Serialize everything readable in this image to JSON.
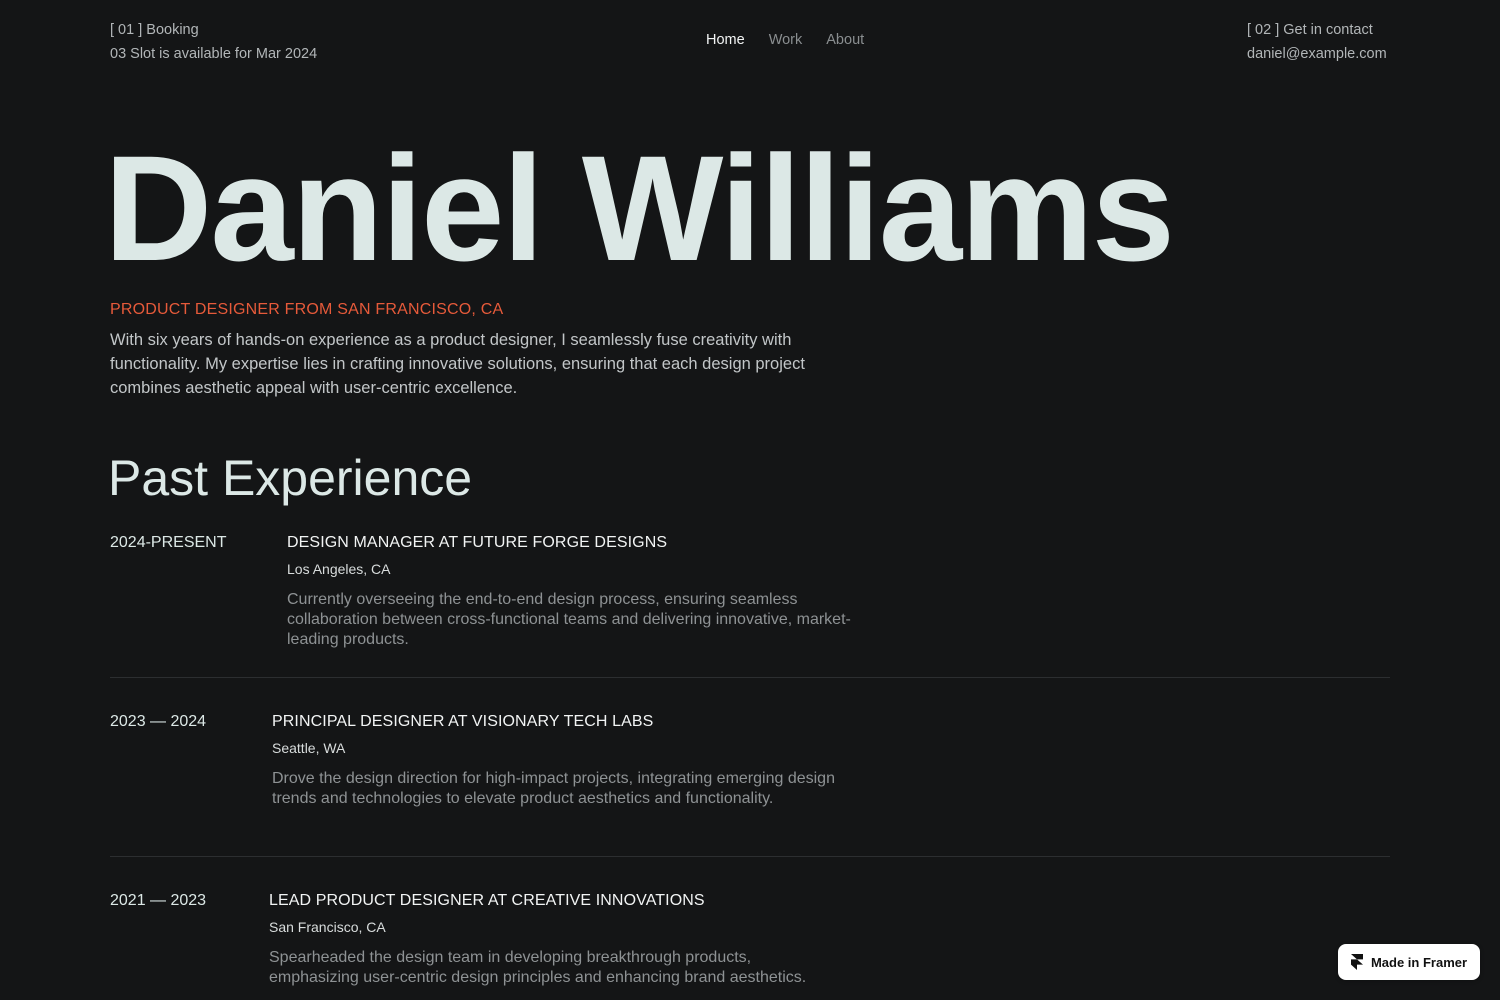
{
  "header": {
    "booking_label": "[ 01 ] Booking",
    "booking_status": "03 Slot is available for Mar 2024",
    "contact_label": "[ 02 ] Get in contact",
    "contact_email": "daniel@example.com",
    "nav": [
      {
        "label": "Home",
        "active": true
      },
      {
        "label": "Work",
        "active": false
      },
      {
        "label": "About",
        "active": false
      }
    ]
  },
  "hero": {
    "name": "Daniel Williams",
    "tagline": "PRODUCT DESIGNER FROM SAN FRANCISCO, CA",
    "intro": "With six years of hands-on experience as a product designer, I seamlessly fuse creativity with functionality. My expertise lies in crafting innovative solutions, ensuring that each design project combines aesthetic appeal with user-centric excellence."
  },
  "experience": {
    "title": "Past Experience",
    "items": [
      {
        "date": "2024-PRESENT",
        "title": "DESIGN MANAGER AT FUTURE FORGE DESIGNS",
        "location": "Los Angeles, CA",
        "description": "Currently overseeing the end-to-end design process, ensuring seamless collaboration between cross-functional teams and delivering innovative, market-leading products."
      },
      {
        "date": "2023 — 2024",
        "title": "PRINCIPAL DESIGNER AT VISIONARY TECH LABS",
        "location": "Seattle, WA",
        "description": "Drove the design direction for high-impact projects, integrating emerging design trends and technologies to elevate product aesthetics and functionality."
      },
      {
        "date": "2021 — 2023",
        "title": "LEAD PRODUCT DESIGNER AT CREATIVE INNOVATIONS",
        "location": "San Francisco, CA",
        "description": "Spearheaded the design team in developing breakthrough products, emphasizing user-centric design principles and enhancing brand aesthetics."
      }
    ]
  },
  "badge": {
    "label": "Made in Framer",
    "icon": "framer-logo-icon"
  },
  "colors": {
    "background": "#141516",
    "accent": "#e65a3a",
    "heading": "#dce8e6"
  }
}
